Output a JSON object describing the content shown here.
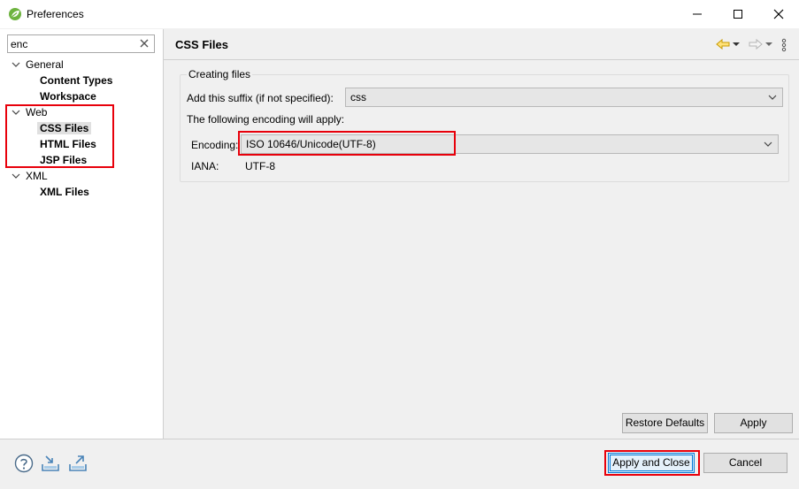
{
  "window": {
    "title": "Preferences",
    "icon": "spring-leaf-icon"
  },
  "filter": {
    "value": "enc"
  },
  "tree": {
    "general": {
      "label": "General",
      "children": [
        "Content Types",
        "Workspace"
      ]
    },
    "web": {
      "label": "Web",
      "children": [
        "CSS Files",
        "HTML Files",
        "JSP Files"
      ],
      "selected": "CSS Files"
    },
    "xml": {
      "label": "XML",
      "children": [
        "XML Files"
      ]
    }
  },
  "page": {
    "title": "CSS Files",
    "group_title": "Creating files",
    "suffix_label": "Add this suffix (if not specified):",
    "suffix_value": "css",
    "encoding_info": "The following encoding will apply:",
    "encoding_label": "Encoding:",
    "encoding_value": "ISO 10646/Unicode(UTF-8)",
    "iana_label": "IANA:",
    "iana_value": "UTF-8"
  },
  "buttons": {
    "restore_defaults": "Restore Defaults",
    "apply": "Apply",
    "apply_and_close": "Apply and Close",
    "cancel": "Cancel"
  },
  "colors": {
    "highlight": "#e8000b",
    "focus": "#0078d7",
    "back_arrow": "#e8b400"
  }
}
